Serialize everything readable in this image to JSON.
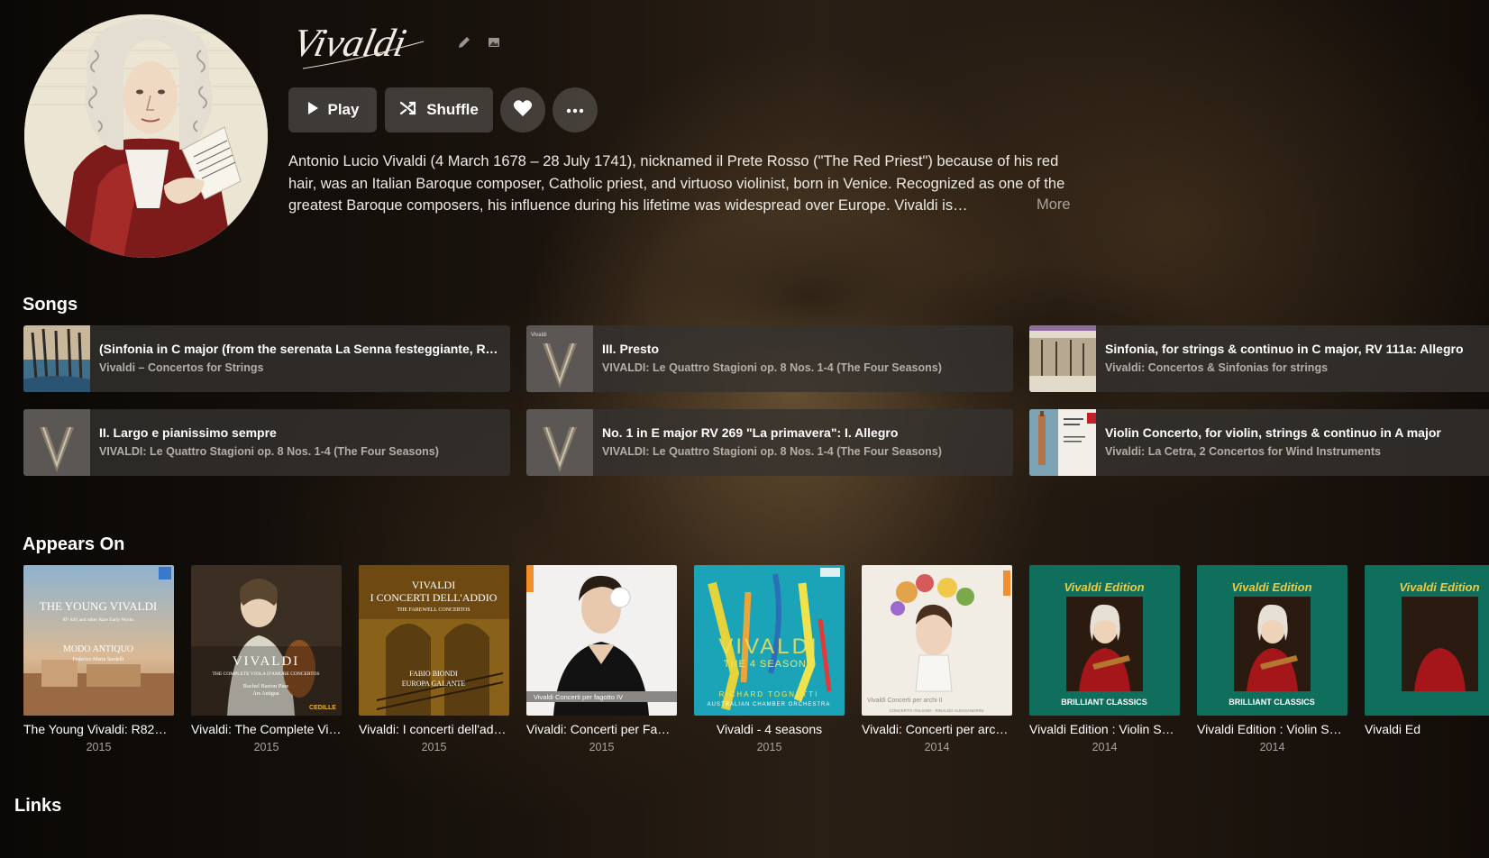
{
  "artist": {
    "name": "Vivaldi",
    "bio": "Antonio Lucio Vivaldi (4 March 1678 – 28 July 1741), nicknamed il Prete Rosso (\"The Red Priest\") because of his red hair, was an Italian Baroque composer, Catholic priest, and virtuoso violinist, born in Venice. Recognized as one of the greatest Baroque composers, his influence during his lifetime was widespread over Europe. Vivaldi is…",
    "more_label": "More"
  },
  "actions": {
    "play_label": "Play",
    "shuffle_label": "Shuffle"
  },
  "sections": {
    "songs": "Songs",
    "appears_on": "Appears On",
    "links": "Links"
  },
  "songs": [
    {
      "title": "(Sinfonia in C major (from the serenata La Senna festeggiante, RV693))...",
      "album": "Vivaldi – Concertos for Strings",
      "thumb": "gondola-blue"
    },
    {
      "title": "III. Presto",
      "album": "VIVALDI: Le Quattro Stagioni op. 8 Nos. 1-4 (The Four Seasons)",
      "thumb": "four-seasons"
    },
    {
      "title": "Sinfonia, for strings & continuo in C major, RV 111a: Allegro",
      "album": "Vivaldi: Concertos & Sinfonias for strings",
      "thumb": "venice-sepia"
    },
    {
      "title": "II. Largo e pianissimo sempre",
      "album": "VIVALDI: Le Quattro Stagioni op. 8 Nos. 1-4 (The Four Seasons)",
      "thumb": "four-seasons"
    },
    {
      "title": "No. 1 in E major RV 269 \"La primavera\": I. Allegro",
      "album": "VIVALDI: Le Quattro Stagioni op. 8 Nos. 1-4 (The Four Seasons)",
      "thumb": "four-seasons"
    },
    {
      "title": "Violin Concerto, for violin, strings & continuo in A major",
      "album": "Vivaldi: La Cetra, 2 Concertos for Wind Instruments",
      "thumb": "la-cetra"
    }
  ],
  "albums": [
    {
      "title": "The Young Vivaldi: R820 ...",
      "year": "2015",
      "cover": "young-vivaldi"
    },
    {
      "title": "Vivaldi: The Complete Vio...",
      "year": "2015",
      "cover": "viola-damore"
    },
    {
      "title": "Vivaldi: I concerti dell'addi...",
      "year": "2015",
      "cover": "addio"
    },
    {
      "title": "Vivaldi: Concerti per Fago...",
      "year": "2015",
      "cover": "fagotto"
    },
    {
      "title": "Vivaldi - 4 seasons",
      "year": "2015",
      "cover": "four-seasons-abstract"
    },
    {
      "title": "Vivaldi: Concerti per archi II",
      "year": "2014",
      "cover": "archi"
    },
    {
      "title": "Vivaldi Edition : Violin Son...",
      "year": "2014",
      "cover": "vivaldi-edition"
    },
    {
      "title": "Vivaldi Edition : Violin Son...",
      "year": "2014",
      "cover": "vivaldi-edition"
    },
    {
      "title": "Vivaldi Ed",
      "year": "",
      "cover": "vivaldi-edition"
    }
  ],
  "covers": {
    "young_vivaldi": {
      "title": "THE YOUNG VIVALDI",
      "sub": "RV 820 and other Rare Early Works",
      "ens": "MODO ANTIQUO",
      "cond": "Federico Maria Sardelli"
    },
    "viola": {
      "title": "VIVALDI",
      "sub": "THE COMPLETE VIOLA D'AMORE CONCERTOS",
      "art": "Rachel Barton Pine",
      "ens": "Ars Antigua",
      "label": "CEDILLE"
    },
    "addio": {
      "l1": "VIVALDI",
      "l2": "I CONCERTI DELL'ADDIO",
      "l3": "THE FAREWELL CONCERTOS",
      "l4": "FABIO BIONDI",
      "l5": "EUROPA GALANTE"
    },
    "fagotto": {
      "line": "Vivaldi  Concerti per fagotto IV"
    },
    "seasons": {
      "title": "VIVALDI",
      "sub": "THE 4 SEASONS",
      "art": "RICHARD TOGNETTI",
      "ens": "AUSTRALIAN CHAMBER ORCHESTRA"
    },
    "archi": {
      "line": "Vivaldi  Concerti per archi  II",
      "ens": "CONCERTO ITALIANO · RINALDO ALESSANDRINI"
    },
    "edition": {
      "title": "Vivaldi Edition",
      "label": "BRILLIANT CLASSICS"
    },
    "cetra": {
      "title": "VIVALDI LA CETRA"
    },
    "seasons_thumb": {
      "label": "Vivaldi"
    }
  },
  "colors": {
    "card_bg": "#343230",
    "button_bg": "rgba(255,255,255,0.18)",
    "edition_green": "#0f6f5c",
    "seasons_teal": "#1ba3b7"
  }
}
